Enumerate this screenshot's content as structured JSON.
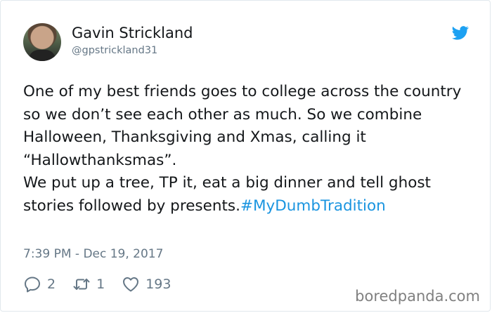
{
  "user": {
    "display_name": "Gavin Strickland",
    "handle": "@gpstrickland31",
    "avatar_icon": "user-avatar-photo"
  },
  "brand": {
    "icon": "twitter-bird-icon",
    "color": "#1da1f2"
  },
  "tweet": {
    "line1": "One of my best friends goes to college across the country so we don’t see each other as much. So we combine Halloween, Thanksgiving and Xmas, calling it “Hallowthanksmas”.",
    "line2": "We put up a tree, TP it, eat a big dinner and tell ghost stories followed by presents.",
    "hashtag": "#MyDumbTradition",
    "hashtag_color": "#1b95e0",
    "timestamp": "7:39 PM - Dec 19, 2017"
  },
  "actions": {
    "reply_count": "2",
    "retweet_count": "1",
    "like_count": "193"
  },
  "watermark": "boredpanda.com"
}
